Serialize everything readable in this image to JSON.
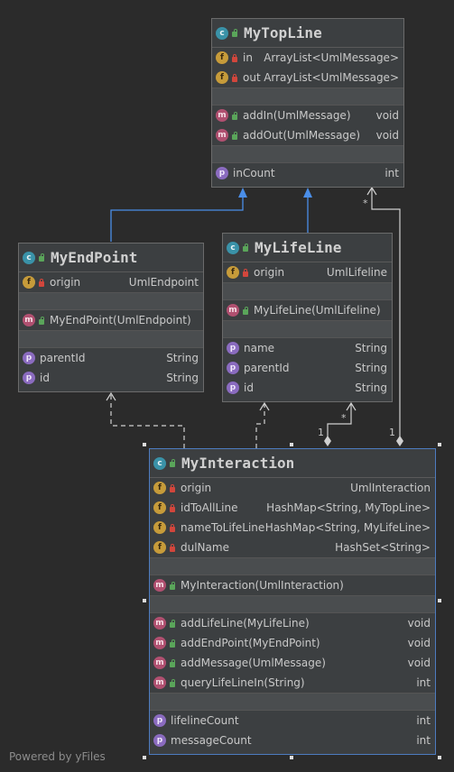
{
  "classes": {
    "topline": {
      "name": "MyTopLine",
      "fields": [
        {
          "name": "in",
          "type": "ArrayList<UmlMessage>"
        },
        {
          "name": "out",
          "type": "ArrayList<UmlMessage>"
        }
      ],
      "methods": [
        {
          "name": "addIn(UmlMessage)",
          "type": "void"
        },
        {
          "name": "addOut(UmlMessage)",
          "type": "void"
        }
      ],
      "properties": [
        {
          "name": "inCount",
          "type": "int"
        }
      ]
    },
    "endpoint": {
      "name": "MyEndPoint",
      "fields": [
        {
          "name": "origin",
          "type": "UmlEndpoint"
        }
      ],
      "constructors": [
        {
          "name": "MyEndPoint(UmlEndpoint)"
        }
      ],
      "properties": [
        {
          "name": "parentId",
          "type": "String"
        },
        {
          "name": "id",
          "type": "String"
        }
      ]
    },
    "lifeline": {
      "name": "MyLifeLine",
      "fields": [
        {
          "name": "origin",
          "type": "UmlLifeline"
        }
      ],
      "constructors": [
        {
          "name": "MyLifeLine(UmlLifeline)"
        }
      ],
      "properties": [
        {
          "name": "name",
          "type": "String"
        },
        {
          "name": "parentId",
          "type": "String"
        },
        {
          "name": "id",
          "type": "String"
        }
      ]
    },
    "interaction": {
      "name": "MyInteraction",
      "fields": [
        {
          "name": "origin",
          "type": "UmlInteraction"
        },
        {
          "name": "idToAllLine",
          "type": "HashMap<String, MyTopLine>"
        },
        {
          "name": "nameToLifeLine",
          "type": "HashMap<String, MyLifeLine>"
        },
        {
          "name": "dulName",
          "type": "HashSet<String>"
        }
      ],
      "constructors": [
        {
          "name": "MyInteraction(UmlInteraction)"
        }
      ],
      "methods": [
        {
          "name": "addLifeLine(MyLifeLine)",
          "type": "void"
        },
        {
          "name": "addEndPoint(MyEndPoint)",
          "type": "void"
        },
        {
          "name": "addMessage(UmlMessage)",
          "type": "void"
        },
        {
          "name": "queryLifeLineIn(String)",
          "type": "int"
        }
      ],
      "properties": [
        {
          "name": "lifelineCount",
          "type": "int"
        },
        {
          "name": "messageCount",
          "type": "int"
        }
      ]
    }
  },
  "icons": {
    "class": "c",
    "field": "f",
    "method": "m",
    "property": "p"
  },
  "multiplicity": {
    "lifeline_star": "*",
    "lifeline_one": "1",
    "topline_star": "*",
    "topline_one": "1"
  },
  "watermark": "Powered by yFiles",
  "colors": {
    "background": "#2b2b2b",
    "box": "#3c3f41",
    "inherit_arrow": "#4a8ee8",
    "relation_line": "#d0d0d0",
    "selection": "#4d7cc0"
  }
}
